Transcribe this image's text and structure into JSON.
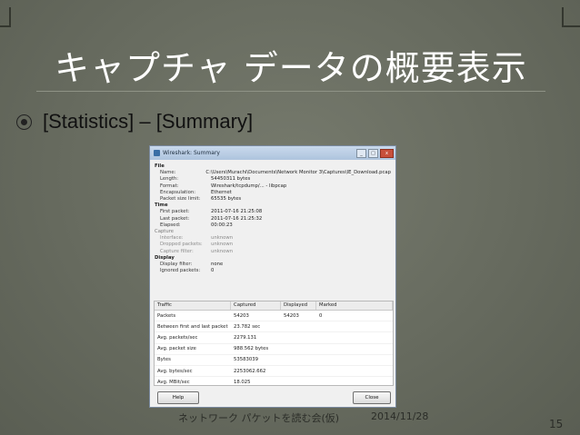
{
  "slide": {
    "title": "キャプチャ データの概要表示",
    "bullet": "[Statistics] – [Summary]",
    "footer_left": "ネットワーク パケットを読む会(仮)",
    "footer_date": "2014/11/28",
    "page_number": "15"
  },
  "window": {
    "title": "Wireshark: Summary",
    "sections": {
      "file": "File",
      "time": "Time",
      "capture": "Capture",
      "display": "Display"
    },
    "file": [
      {
        "k": "Name:",
        "v": "C:\\Users\\Murachi\\Documents\\Network Monitor 3\\Captures\\IE_Download.pcap"
      },
      {
        "k": "Length:",
        "v": "54450311 bytes"
      },
      {
        "k": "Format:",
        "v": "Wireshark/tcpdump/... - libpcap"
      },
      {
        "k": "Encapsulation:",
        "v": "Ethernet"
      },
      {
        "k": "Packet size limit:",
        "v": "65535 bytes"
      }
    ],
    "time": [
      {
        "k": "First packet:",
        "v": "2011-07-16 21:25:08"
      },
      {
        "k": "Last packet:",
        "v": "2011-07-16 21:25:32"
      },
      {
        "k": "Elapsed:",
        "v": "00:00:23"
      }
    ],
    "capture": [
      {
        "k": "Interface:",
        "v": "unknown"
      },
      {
        "k": "Dropped packets:",
        "v": "unknown"
      },
      {
        "k": "Capture filter:",
        "v": "unknown"
      }
    ],
    "display": [
      {
        "k": "Display filter:",
        "v": "none"
      },
      {
        "k": "Ignored packets:",
        "v": "0"
      }
    ],
    "table": {
      "headers": [
        "Traffic",
        "Captured",
        "Displayed",
        "Marked"
      ],
      "rows": [
        [
          "Packets",
          "54203",
          "54203",
          "0"
        ],
        [
          "Between first and last packet",
          "23.782 sec",
          "",
          ""
        ],
        [
          "Avg. packets/sec",
          "2279.131",
          "",
          ""
        ],
        [
          "Avg. packet size",
          "988.562 bytes",
          "",
          ""
        ],
        [
          "Bytes",
          "53583039",
          "",
          ""
        ],
        [
          "Avg. bytes/sec",
          "2253062.662",
          "",
          ""
        ],
        [
          "Avg. MBit/sec",
          "18.025",
          "",
          ""
        ]
      ]
    },
    "help_label": "Help",
    "close_label": "Close"
  },
  "icons": {
    "bullet": "target-bullet-icon",
    "app": "wireshark-app-icon"
  }
}
